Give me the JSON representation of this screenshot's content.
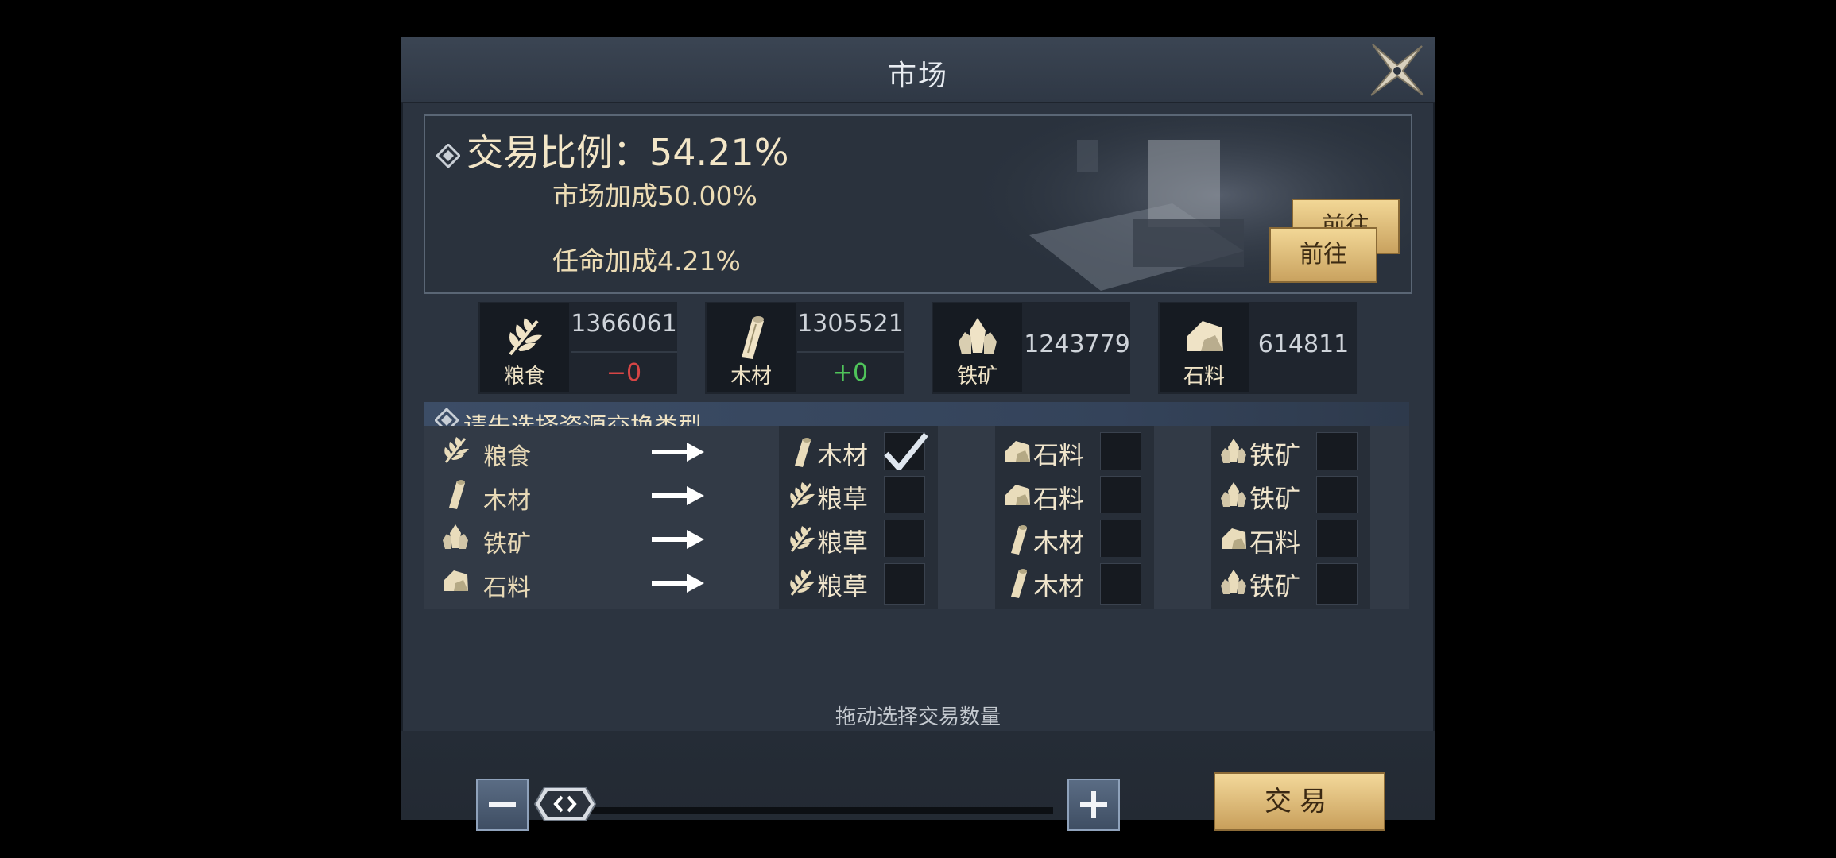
{
  "window": {
    "title": "市场"
  },
  "info": {
    "ratio_text": "交易比例：54.21%",
    "market_bonus": "市场加成50.00%",
    "appoint_bonus": "任命加成4.21%",
    "go_button_1": "前往",
    "go_button_2": "前往"
  },
  "resources": [
    {
      "name": "粮食",
      "amount": "1366061",
      "delta": "−0",
      "delta_color": "#d64545"
    },
    {
      "name": "木材",
      "amount": "1305521",
      "delta": "+0",
      "delta_color": "#4fc45a"
    },
    {
      "name": "铁矿",
      "amount": "1243779"
    },
    {
      "name": "石料",
      "amount": "614811"
    }
  ],
  "section": {
    "title": "请先选择资源交换类型"
  },
  "exchange_rows": [
    {
      "source": "粮食",
      "options": [
        {
          "label": "木材",
          "checked": true
        },
        {
          "label": "石料",
          "checked": false
        },
        {
          "label": "铁矿",
          "checked": false
        }
      ]
    },
    {
      "source": "木材",
      "options": [
        {
          "label": "粮草",
          "checked": false
        },
        {
          "label": "石料",
          "checked": false
        },
        {
          "label": "铁矿",
          "checked": false
        }
      ]
    },
    {
      "source": "铁矿",
      "options": [
        {
          "label": "粮草",
          "checked": false
        },
        {
          "label": "木材",
          "checked": false
        },
        {
          "label": "石料",
          "checked": false
        }
      ]
    },
    {
      "source": "石料",
      "options": [
        {
          "label": "粮草",
          "checked": false
        },
        {
          "label": "木材",
          "checked": false
        },
        {
          "label": "铁矿",
          "checked": false
        }
      ]
    }
  ],
  "quantity": {
    "hint": "拖动选择交易数量",
    "slider_fraction": 0.0
  },
  "trade_button": "交易",
  "colors": {
    "gold": "#e3c27e",
    "panel": "#2c3440",
    "accent_text": "#f1e4c4"
  },
  "icons": [
    "close-icon",
    "grain-icon",
    "wood-icon",
    "iron-icon",
    "stone-icon",
    "arrow-right-icon",
    "check-icon",
    "minus-icon",
    "plus-icon",
    "slider-handle-icon",
    "diamond-icon"
  ]
}
